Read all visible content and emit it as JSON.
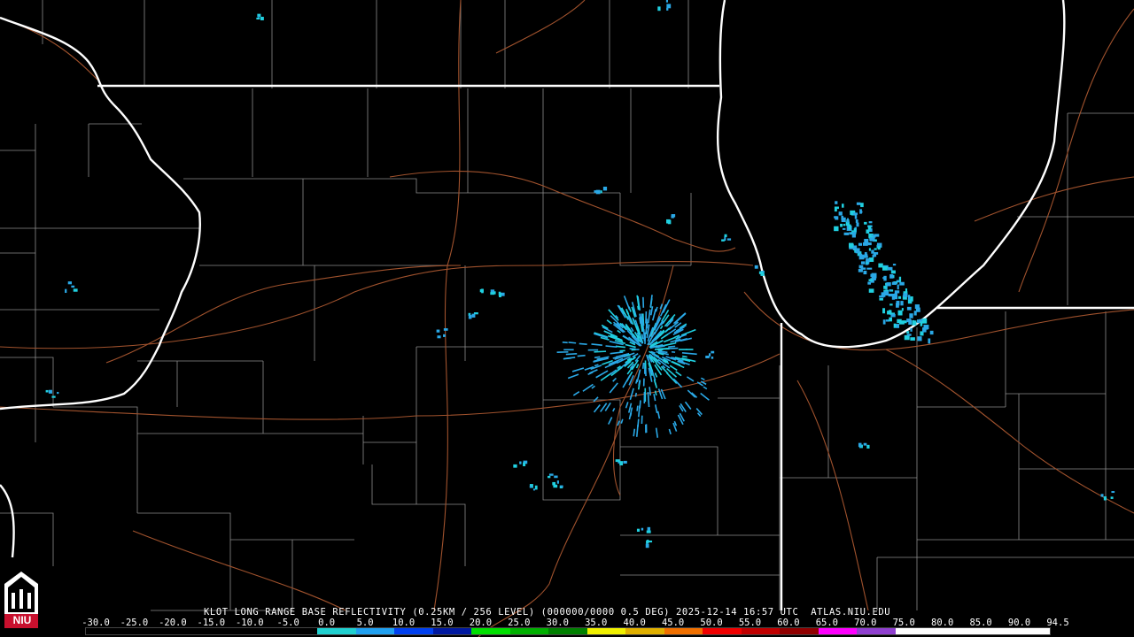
{
  "caption": {
    "station": "KLOT LONG RANGE BASE REFLECTIVITY (0.25KM / 256 LEVEL) (000000/0000 0.5 DEG)",
    "datetime": "2025-12-14 16:57 UTC",
    "source": "ATLAS.NIU.EDU"
  },
  "scale": {
    "ticks": [
      "-30.0",
      "-25.0",
      "-20.0",
      "-15.0",
      "-10.0",
      "-5.0",
      "0.0",
      "5.0",
      "10.0",
      "15.0",
      "20.0",
      "25.0",
      "30.0",
      "35.0",
      "40.0",
      "45.0",
      "50.0",
      "55.0",
      "60.0",
      "65.0",
      "70.0",
      "75.0",
      "80.0",
      "85.0",
      "90.0",
      "94.5"
    ],
    "colors": [
      "#000000",
      "#000000",
      "#000000",
      "#000000",
      "#000000",
      "#000000",
      "#20d0d0",
      "#20a0f0",
      "#0040f0",
      "#0018a0",
      "#00e000",
      "#00b000",
      "#008000",
      "#f0f000",
      "#e0b000",
      "#f07000",
      "#f00000",
      "#c00000",
      "#900000",
      "#ff00ff",
      "#9040d0",
      "#ffffff",
      "#ffffff",
      "#ffffff",
      "#ffffff"
    ]
  },
  "logo": {
    "text": "NIU"
  },
  "colors": {
    "state_lines": "#ffffff",
    "county_lines": "#8c8c8c",
    "roads": "#a0522d",
    "echo_light": "#2aa8e6",
    "echo_cyan": "#20d0e0"
  }
}
